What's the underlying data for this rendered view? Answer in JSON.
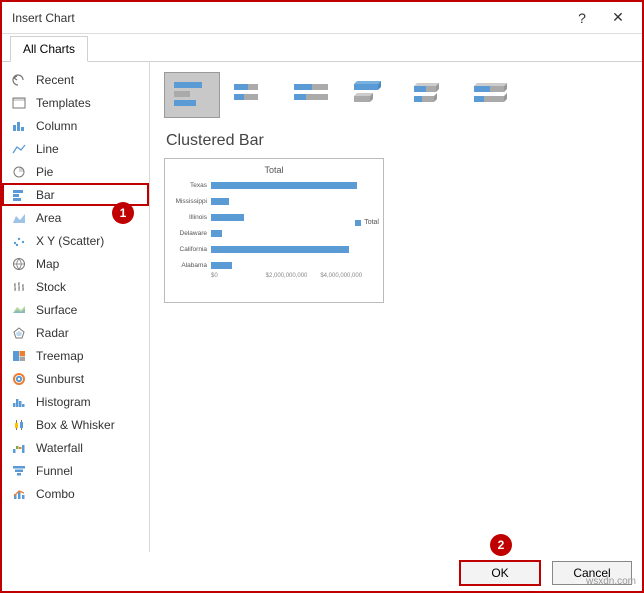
{
  "window": {
    "title": "Insert Chart",
    "help_glyph": "?",
    "close_glyph": "✕"
  },
  "tabs": {
    "all_charts": "All Charts"
  },
  "sidebar": {
    "items": [
      {
        "label": "Recent",
        "icon": "undo-icon"
      },
      {
        "label": "Templates",
        "icon": "templates-icon"
      },
      {
        "label": "Column",
        "icon": "column-chart-icon"
      },
      {
        "label": "Line",
        "icon": "line-chart-icon"
      },
      {
        "label": "Pie",
        "icon": "pie-chart-icon"
      },
      {
        "label": "Bar",
        "icon": "bar-chart-icon",
        "selected": true
      },
      {
        "label": "Area",
        "icon": "area-chart-icon"
      },
      {
        "label": "X Y (Scatter)",
        "icon": "scatter-chart-icon"
      },
      {
        "label": "Map",
        "icon": "map-chart-icon"
      },
      {
        "label": "Stock",
        "icon": "stock-chart-icon"
      },
      {
        "label": "Surface",
        "icon": "surface-chart-icon"
      },
      {
        "label": "Radar",
        "icon": "radar-chart-icon"
      },
      {
        "label": "Treemap",
        "icon": "treemap-chart-icon"
      },
      {
        "label": "Sunburst",
        "icon": "sunburst-chart-icon"
      },
      {
        "label": "Histogram",
        "icon": "histogram-chart-icon"
      },
      {
        "label": "Box & Whisker",
        "icon": "box-whisker-chart-icon"
      },
      {
        "label": "Waterfall",
        "icon": "waterfall-chart-icon"
      },
      {
        "label": "Funnel",
        "icon": "funnel-chart-icon"
      },
      {
        "label": "Combo",
        "icon": "combo-chart-icon"
      }
    ]
  },
  "subtypes": {
    "selected_title": "Clustered Bar",
    "items": [
      {
        "name": "clustered-bar",
        "selected": true
      },
      {
        "name": "stacked-bar"
      },
      {
        "name": "100-stacked-bar"
      },
      {
        "name": "3d-clustered-bar"
      },
      {
        "name": "3d-stacked-bar"
      },
      {
        "name": "3d-100-stacked-bar"
      }
    ]
  },
  "preview": {
    "title": "Total",
    "legend": "Total"
  },
  "chart_data": {
    "type": "bar",
    "title": "Total",
    "categories": [
      "Texas",
      "Mississippi",
      "Illinois",
      "Delaware",
      "California",
      "Alabama"
    ],
    "series": [
      {
        "name": "Total",
        "values": [
          4000000000,
          500000000,
          900000000,
          300000000,
          3800000000,
          600000000
        ]
      }
    ],
    "xlabel": "",
    "ylabel": "",
    "x_ticks": [
      "$0",
      "$2,000,000,000",
      "$4,000,000,000"
    ],
    "xlim": [
      0,
      4500000000
    ],
    "legend_position": "right"
  },
  "footer": {
    "ok": "OK",
    "cancel": "Cancel"
  },
  "annotations": {
    "a1": "1",
    "a2": "2"
  },
  "watermark": "wsxdn.com"
}
